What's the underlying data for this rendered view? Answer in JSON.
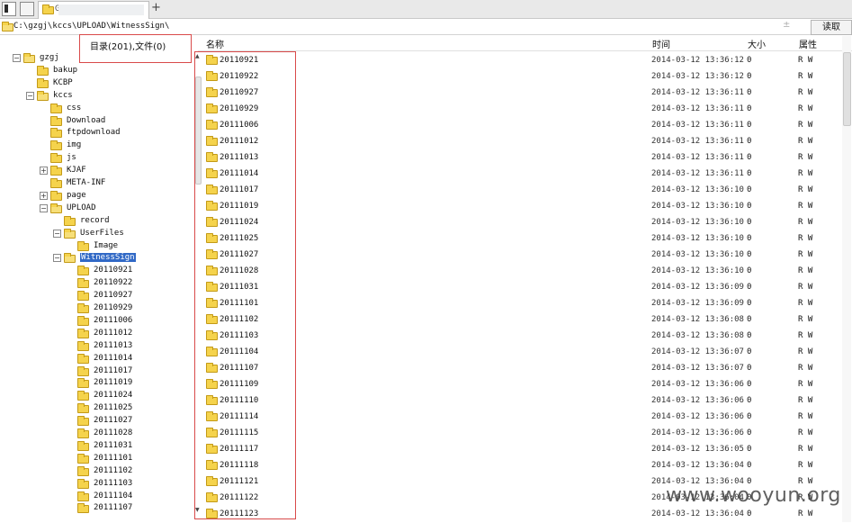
{
  "tabbar": {
    "tab_label": "G",
    "new_tab": "+"
  },
  "address": {
    "path": "C:\\gzgj\\kccs\\UPLOAD\\WitnessSign\\",
    "read_button": "读取",
    "dropdown": "±"
  },
  "summary": "目录(201),文件(0)",
  "columns": {
    "name": "名称",
    "time": "时间",
    "size": "大小",
    "attr": "属性"
  },
  "tree": [
    {
      "label": "gzgj",
      "level": 0,
      "toggle": "−"
    },
    {
      "label": "bakup",
      "level": 1,
      "toggle": ""
    },
    {
      "label": "KCBP",
      "level": 1,
      "toggle": ""
    },
    {
      "label": "kccs",
      "level": 1,
      "toggle": "−"
    },
    {
      "label": "css",
      "level": 2,
      "toggle": ""
    },
    {
      "label": "Download",
      "level": 2,
      "toggle": ""
    },
    {
      "label": "ftpdownload",
      "level": 2,
      "toggle": ""
    },
    {
      "label": "img",
      "level": 2,
      "toggle": ""
    },
    {
      "label": "js",
      "level": 2,
      "toggle": ""
    },
    {
      "label": "KJAF",
      "level": 2,
      "toggle": "+"
    },
    {
      "label": "META-INF",
      "level": 2,
      "toggle": ""
    },
    {
      "label": "page",
      "level": 2,
      "toggle": "+"
    },
    {
      "label": "UPLOAD",
      "level": 2,
      "toggle": "−"
    },
    {
      "label": "record",
      "level": 3,
      "toggle": ""
    },
    {
      "label": "UserFiles",
      "level": 3,
      "toggle": "−"
    },
    {
      "label": "Image",
      "level": 4,
      "toggle": ""
    },
    {
      "label": "WitnessSign",
      "level": 3,
      "toggle": "−",
      "selected": true
    },
    {
      "label": "20110921",
      "level": 4,
      "toggle": ""
    },
    {
      "label": "20110922",
      "level": 4,
      "toggle": ""
    },
    {
      "label": "20110927",
      "level": 4,
      "toggle": ""
    },
    {
      "label": "20110929",
      "level": 4,
      "toggle": ""
    },
    {
      "label": "20111006",
      "level": 4,
      "toggle": ""
    },
    {
      "label": "20111012",
      "level": 4,
      "toggle": ""
    },
    {
      "label": "20111013",
      "level": 4,
      "toggle": ""
    },
    {
      "label": "20111014",
      "level": 4,
      "toggle": ""
    },
    {
      "label": "20111017",
      "level": 4,
      "toggle": ""
    },
    {
      "label": "20111019",
      "level": 4,
      "toggle": ""
    },
    {
      "label": "20111024",
      "level": 4,
      "toggle": ""
    },
    {
      "label": "20111025",
      "level": 4,
      "toggle": ""
    },
    {
      "label": "20111027",
      "level": 4,
      "toggle": ""
    },
    {
      "label": "20111028",
      "level": 4,
      "toggle": ""
    },
    {
      "label": "20111031",
      "level": 4,
      "toggle": ""
    },
    {
      "label": "20111101",
      "level": 4,
      "toggle": ""
    },
    {
      "label": "20111102",
      "level": 4,
      "toggle": ""
    },
    {
      "label": "20111103",
      "level": 4,
      "toggle": ""
    },
    {
      "label": "20111104",
      "level": 4,
      "toggle": ""
    },
    {
      "label": "20111107",
      "level": 4,
      "toggle": ""
    }
  ],
  "files": [
    {
      "name": "20110921",
      "time": "2014-03-12 13:36:12",
      "size": "0",
      "attr": "R W"
    },
    {
      "name": "20110922",
      "time": "2014-03-12 13:36:12",
      "size": "0",
      "attr": "R W"
    },
    {
      "name": "20110927",
      "time": "2014-03-12 13:36:11",
      "size": "0",
      "attr": "R W"
    },
    {
      "name": "20110929",
      "time": "2014-03-12 13:36:11",
      "size": "0",
      "attr": "R W"
    },
    {
      "name": "20111006",
      "time": "2014-03-12 13:36:11",
      "size": "0",
      "attr": "R W"
    },
    {
      "name": "20111012",
      "time": "2014-03-12 13:36:11",
      "size": "0",
      "attr": "R W"
    },
    {
      "name": "20111013",
      "time": "2014-03-12 13:36:11",
      "size": "0",
      "attr": "R W"
    },
    {
      "name": "20111014",
      "time": "2014-03-12 13:36:11",
      "size": "0",
      "attr": "R W"
    },
    {
      "name": "20111017",
      "time": "2014-03-12 13:36:10",
      "size": "0",
      "attr": "R W"
    },
    {
      "name": "20111019",
      "time": "2014-03-12 13:36:10",
      "size": "0",
      "attr": "R W"
    },
    {
      "name": "20111024",
      "time": "2014-03-12 13:36:10",
      "size": "0",
      "attr": "R W"
    },
    {
      "name": "20111025",
      "time": "2014-03-12 13:36:10",
      "size": "0",
      "attr": "R W"
    },
    {
      "name": "20111027",
      "time": "2014-03-12 13:36:10",
      "size": "0",
      "attr": "R W"
    },
    {
      "name": "20111028",
      "time": "2014-03-12 13:36:10",
      "size": "0",
      "attr": "R W"
    },
    {
      "name": "20111031",
      "time": "2014-03-12 13:36:09",
      "size": "0",
      "attr": "R W"
    },
    {
      "name": "20111101",
      "time": "2014-03-12 13:36:09",
      "size": "0",
      "attr": "R W"
    },
    {
      "name": "20111102",
      "time": "2014-03-12 13:36:08",
      "size": "0",
      "attr": "R W"
    },
    {
      "name": "20111103",
      "time": "2014-03-12 13:36:08",
      "size": "0",
      "attr": "R W"
    },
    {
      "name": "20111104",
      "time": "2014-03-12 13:36:07",
      "size": "0",
      "attr": "R W"
    },
    {
      "name": "20111107",
      "time": "2014-03-12 13:36:07",
      "size": "0",
      "attr": "R W"
    },
    {
      "name": "20111109",
      "time": "2014-03-12 13:36:06",
      "size": "0",
      "attr": "R W"
    },
    {
      "name": "20111110",
      "time": "2014-03-12 13:36:06",
      "size": "0",
      "attr": "R W"
    },
    {
      "name": "20111114",
      "time": "2014-03-12 13:36:06",
      "size": "0",
      "attr": "R W"
    },
    {
      "name": "20111115",
      "time": "2014-03-12 13:36:06",
      "size": "0",
      "attr": "R W"
    },
    {
      "name": "20111117",
      "time": "2014-03-12 13:36:05",
      "size": "0",
      "attr": "R W"
    },
    {
      "name": "20111118",
      "time": "2014-03-12 13:36:04",
      "size": "0",
      "attr": "R W"
    },
    {
      "name": "20111121",
      "time": "2014-03-12 13:36:04",
      "size": "0",
      "attr": "R W"
    },
    {
      "name": "20111122",
      "time": "2014-03-12 13:36:04",
      "size": "0",
      "attr": "R W"
    },
    {
      "name": "20111123",
      "time": "2014-03-12 13:36:04",
      "size": "0",
      "attr": "R W"
    }
  ],
  "watermark": "www.wooyun.org"
}
